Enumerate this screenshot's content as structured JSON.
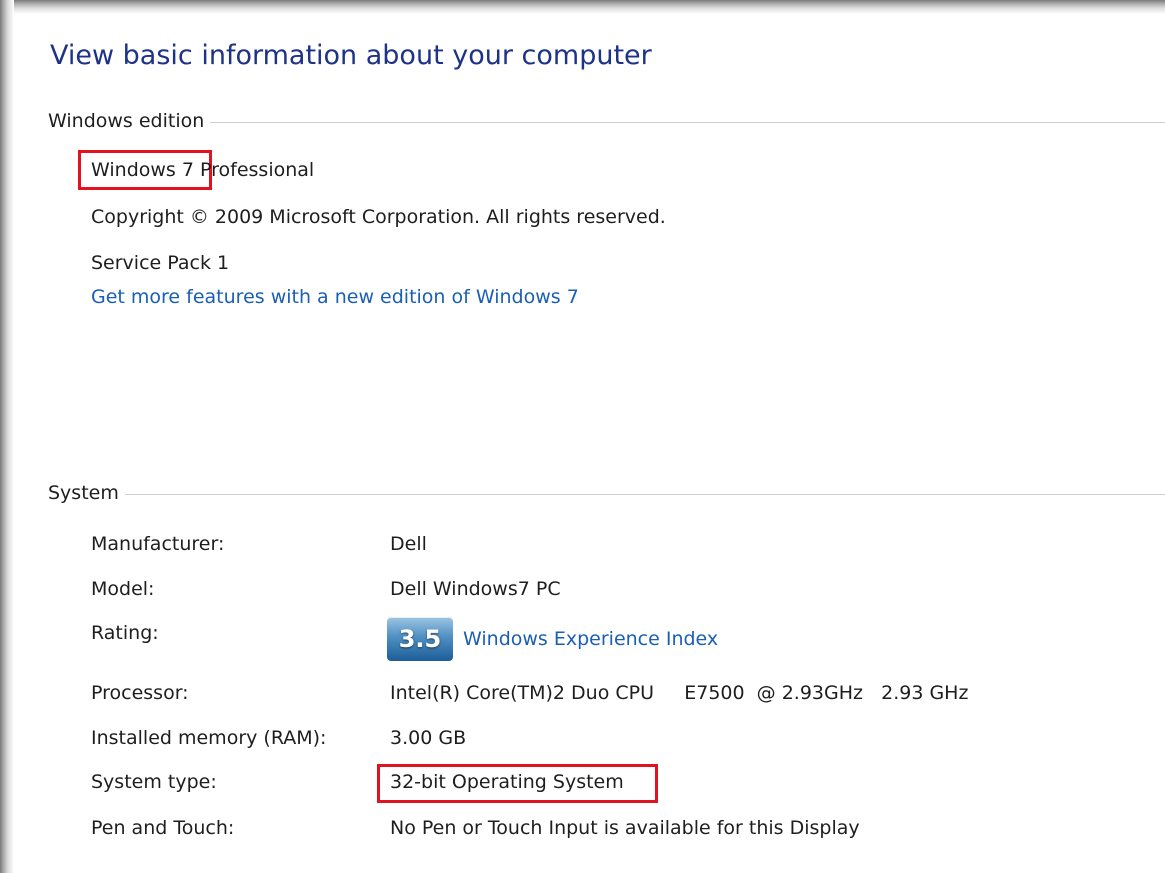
{
  "page_title": "View basic information about your computer",
  "windows_edition": {
    "group_label": "Windows edition",
    "edition_prefix": "Windows 7",
    "edition_suffix": "Professional",
    "copyright": "Copyright © 2009 Microsoft Corporation.  All rights reserved.",
    "service_pack": "Service Pack 1",
    "upgrade_link": "Get more features with a new edition of Windows 7"
  },
  "system": {
    "group_label": "System",
    "manufacturer_label": "Manufacturer:",
    "manufacturer_value": "Dell",
    "model_label": "Model:",
    "model_value": "Dell Windows7 PC",
    "rating_label": "Rating:",
    "rating_score": "3.5",
    "rating_link": "Windows Experience Index",
    "processor_label": "Processor:",
    "processor_value": "Intel(R) Core(TM)2 Duo CPU     E7500  @ 2.93GHz   2.93 GHz",
    "memory_label": "Installed memory (RAM):",
    "memory_value": "3.00 GB",
    "system_type_label": "System type:",
    "system_type_value": "32-bit Operating System",
    "pen_touch_label": "Pen and Touch:",
    "pen_touch_value": "No Pen or Touch Input is available for this Display"
  },
  "colors": {
    "title": "#1e3287",
    "link": "#1a5fb4",
    "highlight_box": "#e0131e"
  }
}
